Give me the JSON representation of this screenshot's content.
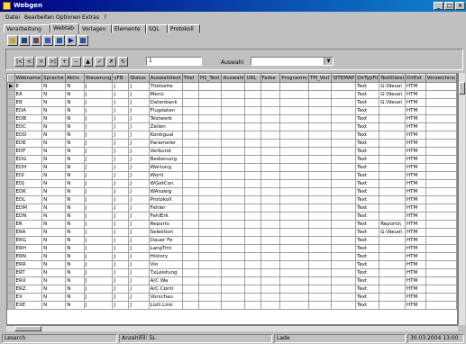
{
  "window": {
    "title": "Webgen"
  },
  "menu": [
    "Datei",
    "Bearbeiten",
    "Optionen",
    "Extras",
    "?"
  ],
  "tabs": [
    "Verarbeitung",
    "Webtab",
    "Vorlagen",
    "Elemente",
    "SQL",
    "Protokoll"
  ],
  "active_tab_index": 1,
  "navigator": {
    "buttons": [
      "|<",
      "<",
      ">",
      ">|",
      "+",
      "−",
      "▲",
      "✓",
      "✗",
      "↻"
    ],
    "record_value": "1",
    "auswahl_label": "Auswahl",
    "auswahl_value": ""
  },
  "grid": {
    "columns": [
      "Webname",
      "Sprache",
      "Aktiv",
      "Steuerung",
      "vFB",
      "Status",
      "Auswahltext",
      "Titel",
      "H1_Text",
      "Auswahl",
      "URL",
      "Farbe",
      "Programm",
      "TM_Vorl",
      "SITEMAP",
      "DirTypFil",
      "TextDatei",
      "DirExt",
      "Verzeichnis"
    ],
    "rows": [
      [
        "E",
        "N",
        "N",
        "J",
        "J",
        "J",
        "Titelseite",
        "",
        "",
        "",
        "",
        "",
        "",
        "",
        "",
        "Text",
        "G:\\Neue\\",
        "HTM",
        ""
      ],
      [
        "EA",
        "N",
        "N",
        "J",
        "J",
        "J",
        "Menü",
        "",
        "",
        "",
        "",
        "",
        "",
        "",
        "",
        "Text",
        "G:\\Neue\\",
        "HTM",
        ""
      ],
      [
        "EB",
        "N",
        "N",
        "J",
        "J",
        "J",
        "Datenbank",
        "",
        "",
        "",
        "",
        "",
        "",
        "",
        "",
        "Text",
        "G:\\Neue\\",
        "HTM",
        ""
      ],
      [
        "EDA",
        "N",
        "N",
        "J",
        "J",
        "J",
        "Flugdaten",
        "",
        "",
        "",
        "",
        "",
        "",
        "",
        "",
        "Text",
        "",
        "HTM",
        ""
      ],
      [
        "EDB",
        "N",
        "N",
        "J",
        "J",
        "J",
        "Textwerk",
        "",
        "",
        "",
        "",
        "",
        "",
        "",
        "",
        "Text",
        "",
        "HTM",
        ""
      ],
      [
        "EDC",
        "N",
        "N",
        "J",
        "J",
        "J",
        "Zeilen",
        "",
        "",
        "",
        "",
        "",
        "",
        "",
        "",
        "Text",
        "",
        "HTM",
        ""
      ],
      [
        "EDD",
        "N",
        "N",
        "J",
        "J",
        "J",
        "Kontigual",
        "",
        "",
        "",
        "",
        "",
        "",
        "",
        "",
        "Text",
        "",
        "HTM",
        ""
      ],
      [
        "EDE",
        "N",
        "N",
        "J",
        "J",
        "J",
        "Parameter",
        "",
        "",
        "",
        "",
        "",
        "",
        "",
        "",
        "Text",
        "",
        "HTM",
        ""
      ],
      [
        "EDF",
        "N",
        "N",
        "J",
        "J",
        "J",
        "Verbund",
        "",
        "",
        "",
        "",
        "",
        "",
        "",
        "",
        "Text",
        "",
        "HTM",
        ""
      ],
      [
        "EDG",
        "N",
        "N",
        "J",
        "J",
        "J",
        "Bedienung",
        "",
        "",
        "",
        "",
        "",
        "",
        "",
        "",
        "Text",
        "",
        "HTM",
        ""
      ],
      [
        "EDH",
        "N",
        "N",
        "J",
        "J",
        "J",
        "Wartung",
        "",
        "",
        "",
        "",
        "",
        "",
        "",
        "",
        "Text",
        "",
        "HTM",
        ""
      ],
      [
        "EDI",
        "N",
        "N",
        "J",
        "J",
        "J",
        "Wortl.",
        "",
        "",
        "",
        "",
        "",
        "",
        "",
        "",
        "Text",
        "",
        "HTM",
        ""
      ],
      [
        "EDJ",
        "N",
        "N",
        "J",
        "J",
        "J",
        "WGetCon",
        "",
        "",
        "",
        "",
        "",
        "",
        "",
        "",
        "Text",
        "",
        "HTM",
        ""
      ],
      [
        "EDK",
        "N",
        "N",
        "J",
        "J",
        "J",
        "WAnzeig",
        "",
        "",
        "",
        "",
        "",
        "",
        "",
        "",
        "Text",
        "",
        "HTM",
        ""
      ],
      [
        "EDL",
        "N",
        "N",
        "J",
        "J",
        "J",
        "Protokoll",
        "",
        "",
        "",
        "",
        "",
        "",
        "",
        "",
        "Text",
        "",
        "HTM",
        ""
      ],
      [
        "EDM",
        "N",
        "N",
        "J",
        "J",
        "J",
        "Fehler",
        "",
        "",
        "",
        "",
        "",
        "",
        "",
        "",
        "Text",
        "",
        "HTM",
        ""
      ],
      [
        "EDN",
        "N",
        "N",
        "J",
        "J",
        "J",
        "FehlErk",
        "",
        "",
        "",
        "",
        "",
        "",
        "",
        "",
        "Text",
        "",
        "HTM",
        ""
      ],
      [
        "ER",
        "N",
        "N",
        "J",
        "J",
        "J",
        "Reports",
        "",
        "",
        "",
        "",
        "",
        "",
        "",
        "",
        "Text",
        "Reports\\",
        "HTM",
        ""
      ],
      [
        "ERA",
        "N",
        "N",
        "J",
        "J",
        "J",
        "Selektion",
        "",
        "",
        "",
        "",
        "",
        "",
        "",
        "",
        "Text",
        "G:\\Neue\\",
        "HTM",
        ""
      ],
      [
        "ERG",
        "N",
        "N",
        "J",
        "J",
        "J",
        "Dauer Fe",
        "",
        "",
        "",
        "",
        "",
        "",
        "",
        "",
        "Text",
        "",
        "HTM",
        ""
      ],
      [
        "ERH",
        "N",
        "N",
        "J",
        "J",
        "J",
        "LangTrnt",
        "",
        "",
        "",
        "",
        "",
        "",
        "",
        "",
        "Text",
        "",
        "HTM",
        ""
      ],
      [
        "ERN",
        "N",
        "N",
        "J",
        "J",
        "J",
        "History",
        "",
        "",
        "",
        "",
        "",
        "",
        "",
        "",
        "Text",
        "",
        "HTM",
        ""
      ],
      [
        "ERR",
        "N",
        "N",
        "J",
        "J",
        "J",
        "Vio",
        "",
        "",
        "",
        "",
        "",
        "",
        "",
        "",
        "Text",
        "",
        "HTM",
        ""
      ],
      [
        "ERT",
        "N",
        "N",
        "J",
        "J",
        "J",
        "TxLeistung",
        "",
        "",
        "",
        "",
        "",
        "",
        "",
        "",
        "Text",
        "",
        "HTM",
        ""
      ],
      [
        "ERX",
        "N",
        "N",
        "J",
        "J",
        "J",
        "A/C Wa",
        "",
        "",
        "",
        "",
        "",
        "",
        "",
        "",
        "Text",
        "",
        "HTM",
        ""
      ],
      [
        "ERZ",
        "N",
        "N",
        "J",
        "J",
        "J",
        "A/C Conti",
        "",
        "",
        "",
        "",
        "",
        "",
        "",
        "",
        "Text",
        "",
        "HTM",
        ""
      ],
      [
        "EX",
        "N",
        "N",
        "J",
        "J",
        "J",
        "Vorschau",
        "",
        "",
        "",
        "",
        "",
        "",
        "",
        "",
        "Text",
        "",
        "HTM",
        ""
      ],
      [
        "EXE",
        "N",
        "N",
        "J",
        "J",
        "J",
        "Listt.Link",
        "",
        "",
        "",
        "",
        "",
        "",
        "",
        "",
        "Text",
        "",
        "HTM",
        ""
      ]
    ]
  },
  "status": {
    "left": "Lesarch",
    "middle": "AnzahlFil: 5L",
    "right": "Lade",
    "datetime": "30.03.2004   13:00"
  }
}
